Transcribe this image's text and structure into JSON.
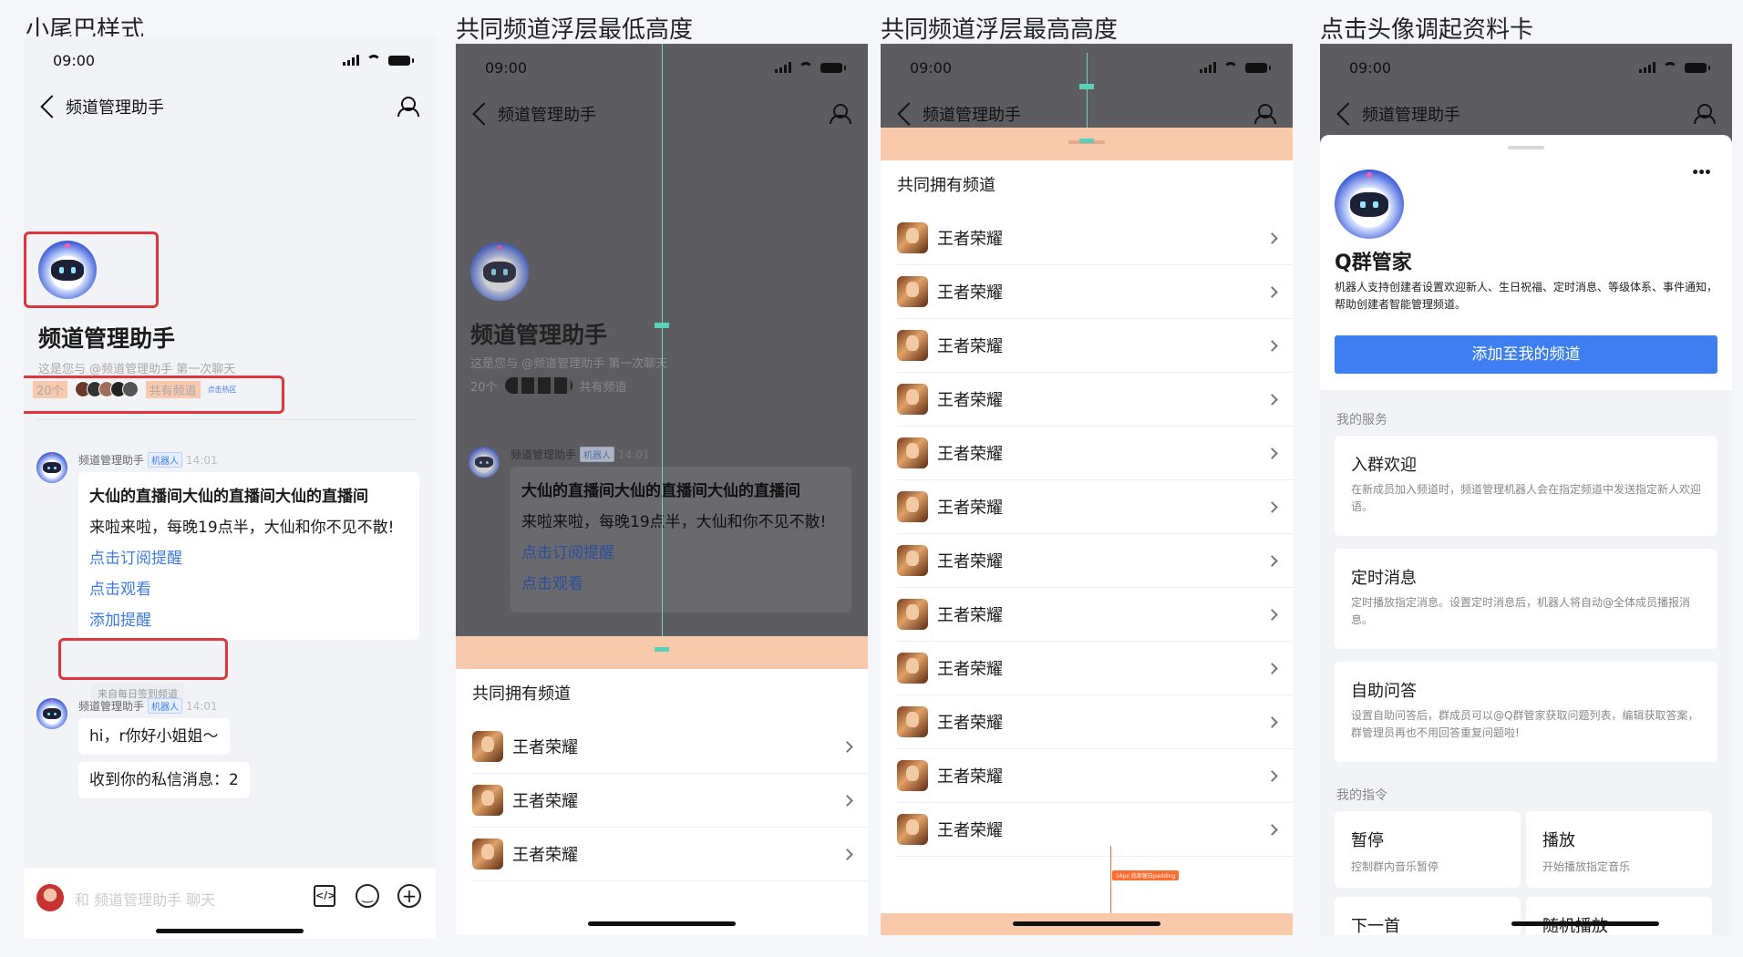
{
  "titles": {
    "p1": "小尾巴样式",
    "p2": "共同频道浮层最低高度",
    "p3": "共同频道浮层最高高度",
    "p4": "点击头像调起资料卡"
  },
  "status": {
    "time": "09:00"
  },
  "nav": {
    "title": "频道管理助手"
  },
  "profile": {
    "name": "频道管理助手",
    "intro": "这是您与 @频道管理助手 第一次聊天",
    "count": "20个",
    "shared": "共有频道",
    "hotzone": "点击热区"
  },
  "messages": {
    "sender": "频道管理助手",
    "role_tag": "机器人",
    "time": "14:01",
    "m1_line1": "大仙的直播间大仙的直播间大仙的直播间",
    "m1_line2": "来啦来啦，每晚19点半，大仙和你不见不散!",
    "m1_link1": "点击订阅提醒",
    "m1_link2": "点击观看",
    "m1_link3": "添加提醒",
    "source_tail": "来自每日签到频道",
    "m2_text": "hi，r你好小姐姐～",
    "m3_text": "收到你的私信消息：2"
  },
  "input": {
    "placeholder": "和 频道管理助手 聊天"
  },
  "sheet": {
    "title": "共同拥有频道",
    "item_label": "王者荣耀",
    "items_min": [
      "王者荣耀",
      "王者荣耀",
      "王者荣耀"
    ],
    "items_max": [
      "王者荣耀",
      "王者荣耀",
      "王者荣耀",
      "王者荣耀",
      "王者荣耀",
      "王者荣耀",
      "王者荣耀",
      "王者荣耀",
      "王者荣耀",
      "王者荣耀",
      "王者荣耀",
      "王者荣耀"
    ],
    "bottom_note": "16px 底部留白padding"
  },
  "card": {
    "name": "Q群管家",
    "desc": "机器人支持创建者设置欢迎新人、生日祝福、定时消息、等级体系、事件通知，帮助创建者智能管理频道。",
    "add_button": "添加至我的频道",
    "more": "•••",
    "services_label": "我的服务",
    "services": [
      {
        "title": "入群欢迎",
        "desc": "在新成员加入频道时，频道管理机器人会在指定频道中发送指定新人欢迎语。"
      },
      {
        "title": "定时消息",
        "desc": "定时播放指定消息。设置定时消息后，机器人将自动@全体成员播报消息。"
      },
      {
        "title": "自助问答",
        "desc": "设置自助问答后，群成员可以@Q群管家获取问题列表，编辑获取答案，群管理员再也不用回答重复问题啦!"
      }
    ],
    "commands_label": "我的指令",
    "commands": [
      {
        "title": "暂停",
        "desc": "控制群内音乐暂停"
      },
      {
        "title": "播放",
        "desc": "开始播放指定音乐"
      },
      {
        "title": "下一首",
        "desc": ""
      },
      {
        "title": "随机播放",
        "desc": ""
      }
    ]
  },
  "colors": {
    "accent": "#3d7ff2",
    "sheet_head": "#f8c9aa",
    "annotation_red": "#e0353a"
  }
}
